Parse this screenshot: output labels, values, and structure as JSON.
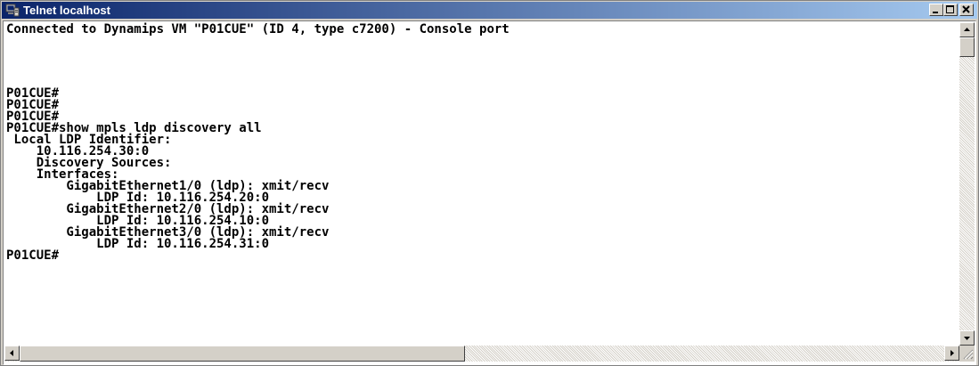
{
  "window": {
    "title": "Telnet localhost",
    "icon": "telnet-icon",
    "controls": [
      "minimize-icon",
      "maximize-icon",
      "close-icon"
    ]
  },
  "terminal": {
    "lines": [
      "Connected to Dynamips VM \"P01CUE\" (ID 4, type c7200) - Console port",
      "",
      "",
      "P01CUE#",
      "P01CUE#",
      "P01CUE#",
      "P01CUE#show mpls ldp discovery all",
      " Local LDP Identifier:",
      "    10.116.254.30:0",
      "    Discovery Sources:",
      "    Interfaces:",
      "        GigabitEthernet1/0 (ldp): xmit/recv",
      "            LDP Id: 10.116.254.20:0",
      "        GigabitEthernet2/0 (ldp): xmit/recv",
      "            LDP Id: 10.116.254.10:0",
      "        GigabitEthernet3/0 (ldp): xmit/recv",
      "            LDP Id: 10.116.254.31:0",
      "P01CUE#"
    ]
  },
  "colors": {
    "terminal_bg": "#ffffff",
    "terminal_fg": "#000000",
    "titlebar_start": "#0a246a",
    "titlebar_end": "#a6caf0"
  }
}
